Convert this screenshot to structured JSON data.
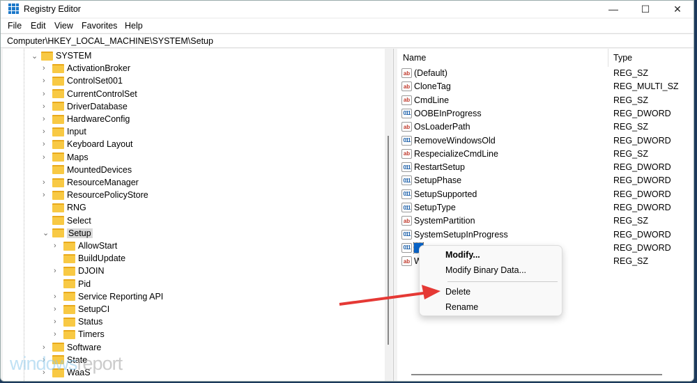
{
  "window": {
    "title": "Registry Editor",
    "minimize": "—",
    "maximize": "☐",
    "close": "✕"
  },
  "menu": [
    "File",
    "Edit",
    "View",
    "Favorites",
    "Help"
  ],
  "address": "Computer\\HKEY_LOCAL_MACHINE\\SYSTEM\\Setup",
  "tree": [
    {
      "label": "SYSTEM",
      "level": 0,
      "expanded": true
    },
    {
      "label": "ActivationBroker",
      "level": 1,
      "chev": true
    },
    {
      "label": "ControlSet001",
      "level": 1,
      "chev": true
    },
    {
      "label": "CurrentControlSet",
      "level": 1,
      "chev": true
    },
    {
      "label": "DriverDatabase",
      "level": 1,
      "chev": true
    },
    {
      "label": "HardwareConfig",
      "level": 1,
      "chev": true
    },
    {
      "label": "Input",
      "level": 1,
      "chev": true
    },
    {
      "label": "Keyboard Layout",
      "level": 1,
      "chev": true
    },
    {
      "label": "Maps",
      "level": 1,
      "chev": true
    },
    {
      "label": "MountedDevices",
      "level": 1,
      "chev": false
    },
    {
      "label": "ResourceManager",
      "level": 1,
      "chev": true
    },
    {
      "label": "ResourcePolicyStore",
      "level": 1,
      "chev": true
    },
    {
      "label": "RNG",
      "level": 1,
      "chev": false
    },
    {
      "label": "Select",
      "level": 1,
      "chev": false
    },
    {
      "label": "Setup",
      "level": 1,
      "expanded": true,
      "selected": true
    },
    {
      "label": "AllowStart",
      "level": 2,
      "chev": true
    },
    {
      "label": "BuildUpdate",
      "level": 2,
      "chev": false
    },
    {
      "label": "DJOIN",
      "level": 2,
      "chev": true
    },
    {
      "label": "Pid",
      "level": 2,
      "chev": false
    },
    {
      "label": "Service Reporting API",
      "level": 2,
      "chev": true
    },
    {
      "label": "SetupCI",
      "level": 2,
      "chev": true
    },
    {
      "label": "Status",
      "level": 2,
      "chev": true
    },
    {
      "label": "Timers",
      "level": 2,
      "chev": true
    },
    {
      "label": "Software",
      "level": 1,
      "chev": true
    },
    {
      "label": "State",
      "level": 1,
      "chev": true
    },
    {
      "label": "WaaS",
      "level": 1,
      "chev": true
    }
  ],
  "columns": {
    "name": "Name",
    "type": "Type"
  },
  "values": [
    {
      "name": "(Default)",
      "type": "REG_SZ",
      "icon": "ab"
    },
    {
      "name": "CloneTag",
      "type": "REG_MULTI_SZ",
      "icon": "ab"
    },
    {
      "name": "CmdLine",
      "type": "REG_SZ",
      "icon": "ab"
    },
    {
      "name": "OOBEInProgress",
      "type": "REG_DWORD",
      "icon": "011"
    },
    {
      "name": "OsLoaderPath",
      "type": "REG_SZ",
      "icon": "ab"
    },
    {
      "name": "RemoveWindowsOld",
      "type": "REG_DWORD",
      "icon": "011"
    },
    {
      "name": "RespecializeCmdLine",
      "type": "REG_SZ",
      "icon": "ab"
    },
    {
      "name": "RestartSetup",
      "type": "REG_DWORD",
      "icon": "011"
    },
    {
      "name": "SetupPhase",
      "type": "REG_DWORD",
      "icon": "011"
    },
    {
      "name": "SetupSupported",
      "type": "REG_DWORD",
      "icon": "011"
    },
    {
      "name": "SetupType",
      "type": "REG_DWORD",
      "icon": "011"
    },
    {
      "name": "SystemPartition",
      "type": "REG_SZ",
      "icon": "ab"
    },
    {
      "name": "SystemSetupInProgress",
      "type": "REG_DWORD",
      "icon": "011"
    },
    {
      "name": "U",
      "type": "REG_DWORD",
      "icon": "011",
      "selected": true
    },
    {
      "name": "W",
      "type": "REG_SZ",
      "icon": "ab"
    }
  ],
  "context_menu": {
    "modify": "Modify...",
    "modify_binary": "Modify Binary Data...",
    "delete": "Delete",
    "rename": "Rename"
  },
  "watermark": {
    "a": "windows",
    "b": "report"
  },
  "colors": {
    "arrow": "#e53935",
    "selection": "#0a64c8"
  }
}
